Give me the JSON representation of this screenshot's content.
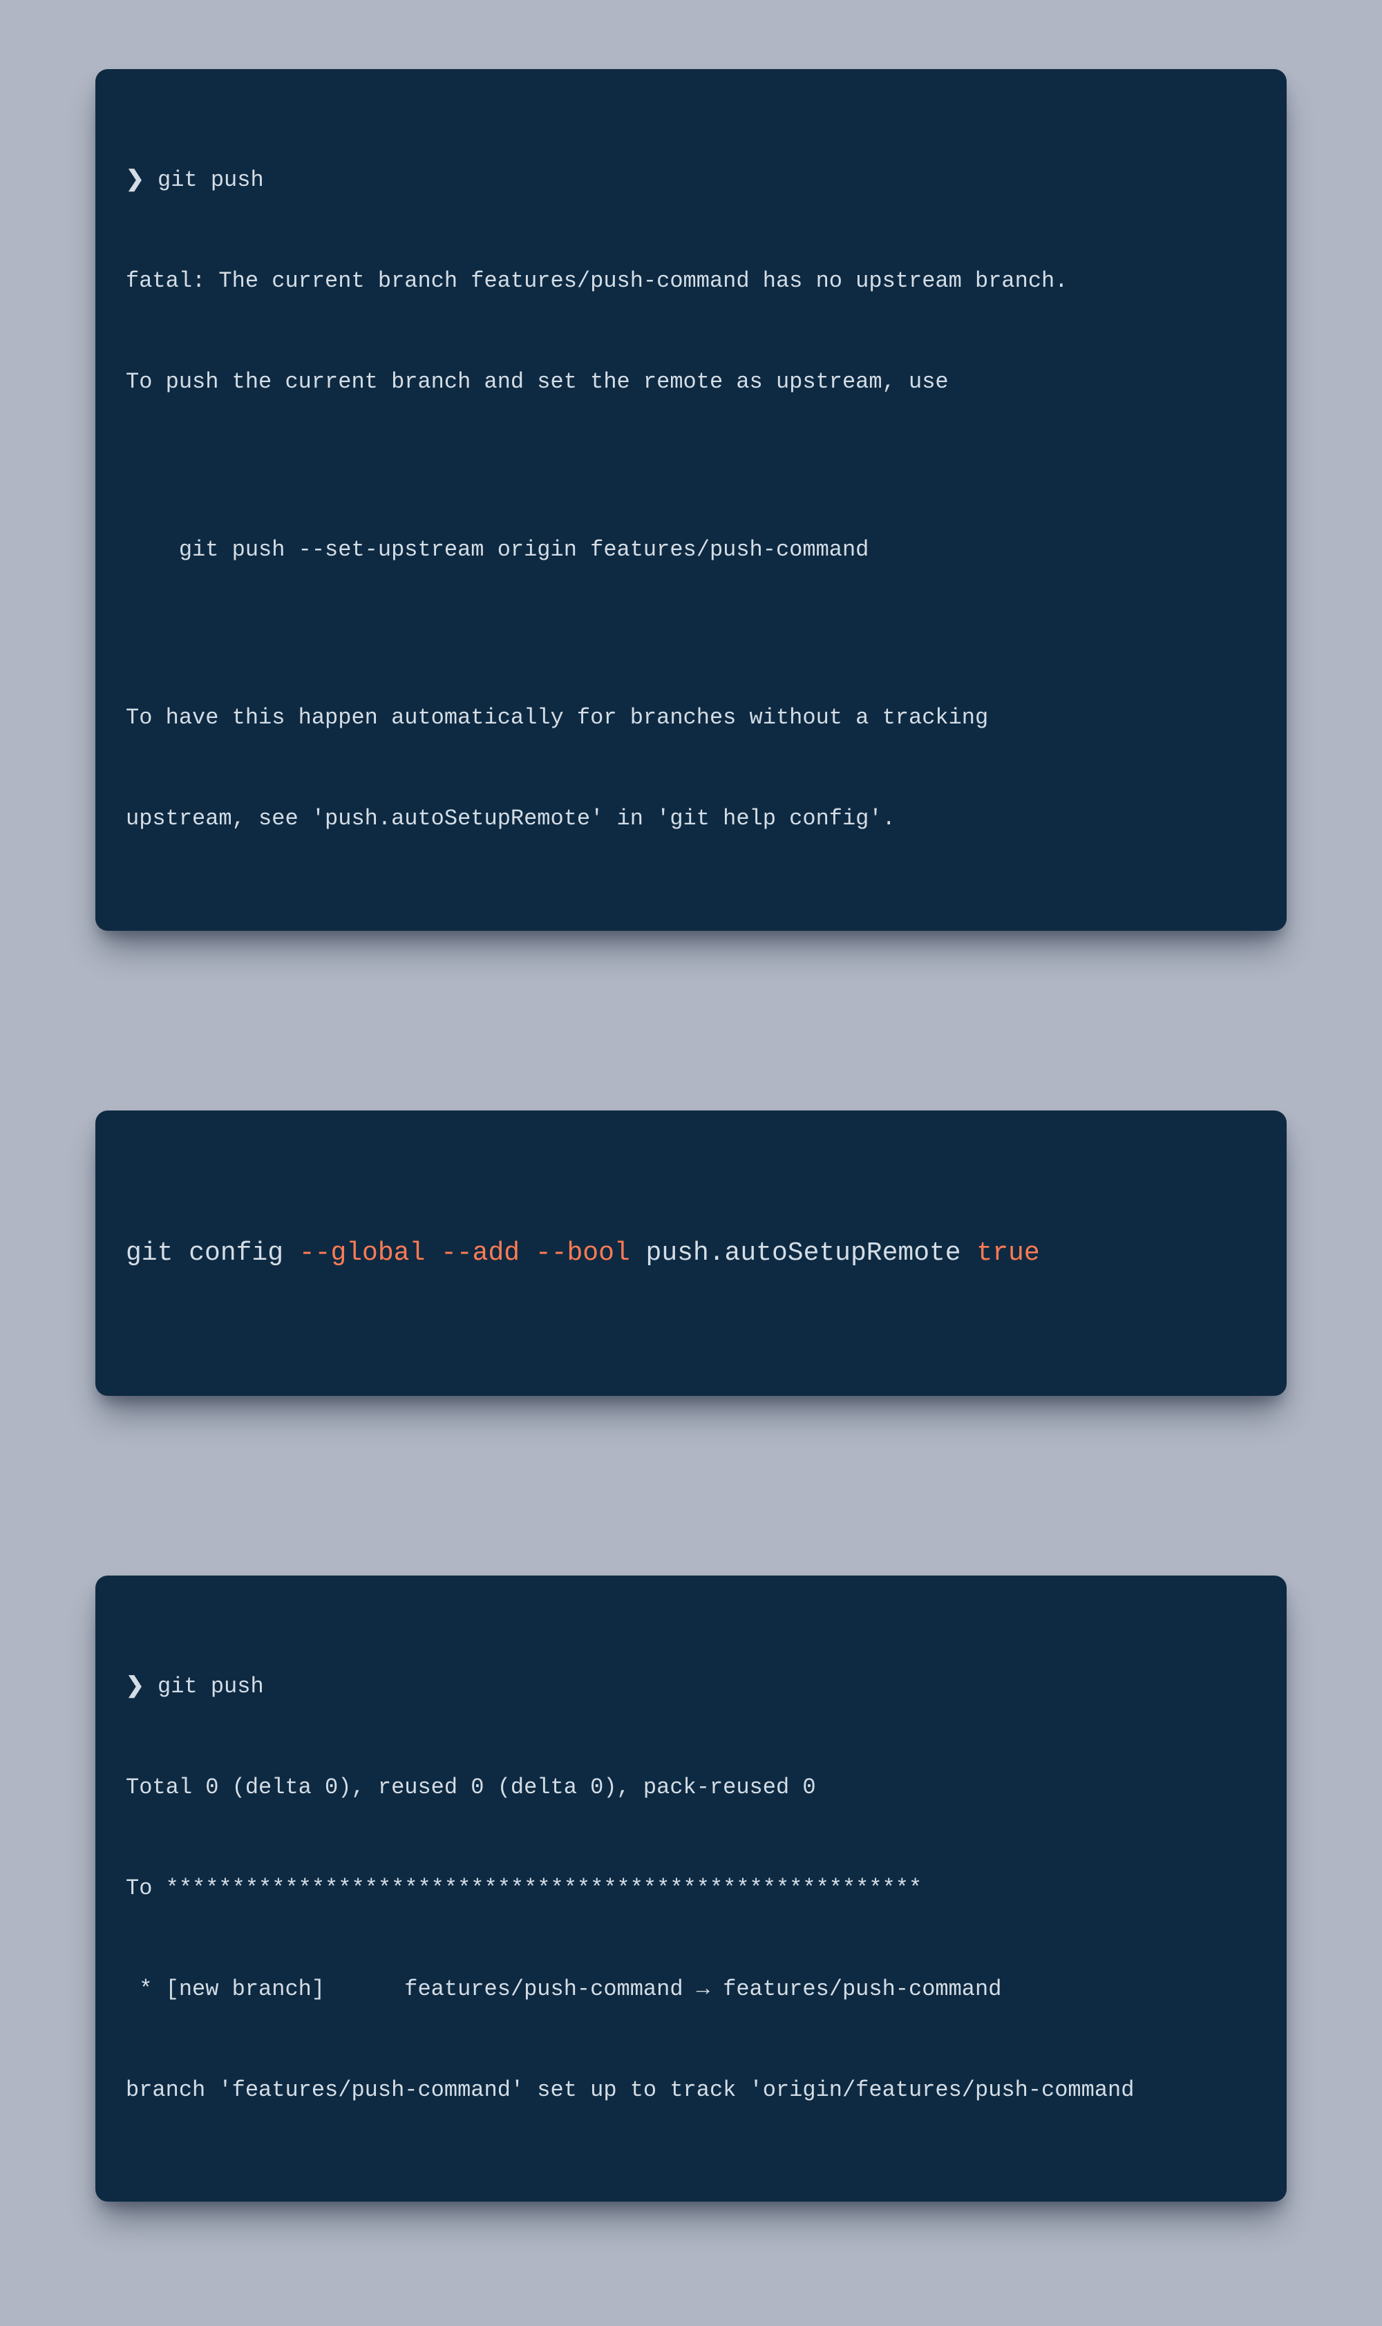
{
  "colors": {
    "page_bg": "#b0b6c3",
    "terminal_bg": "#0e2a42",
    "terminal_fg": "#d4dde6",
    "accent": "#ff7b54"
  },
  "block1": {
    "prompt": "❯",
    "command": "git push",
    "output": [
      "fatal: The current branch features/push-command has no upstream branch.",
      "To push the current branch and set the remote as upstream, use",
      "",
      "    git push --set-upstream origin features/push-command",
      "",
      "To have this happen automatically for branches without a tracking",
      "upstream, see 'push.autoSetupRemote' in 'git help config'."
    ]
  },
  "block2": {
    "segments": [
      {
        "text": "git config ",
        "accent": false
      },
      {
        "text": "--global --add --bool",
        "accent": true
      },
      {
        "text": " push.autoSetupRemote ",
        "accent": false
      },
      {
        "text": "true",
        "accent": true
      }
    ]
  },
  "block3": {
    "prompt": "❯",
    "command": "git push",
    "output": [
      "Total 0 (delta 0), reused 0 (delta 0), pack-reused 0",
      "To *********************************************************",
      " * [new branch]      features/push-command → features/push-command",
      "branch 'features/push-command' set up to track 'origin/features/push-command"
    ]
  }
}
